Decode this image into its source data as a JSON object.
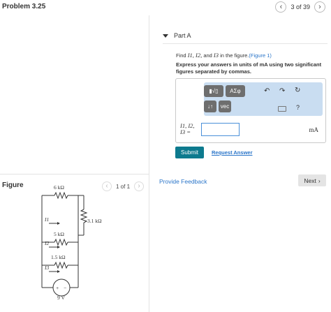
{
  "header": {
    "problem_title": "Problem 3.25",
    "pager_text": "3 of 39",
    "prev_icon": "chevron-left-icon",
    "next_icon": "chevron-right-icon"
  },
  "part": {
    "label": "Part A",
    "prompt_prefix": "Find ",
    "prompt_vars": "I1, I2,",
    "prompt_mid": " and ",
    "prompt_var3": "I3",
    "prompt_suffix": " in the figure.",
    "figure_link": "(Figure 1)",
    "instruction": "Express your answers in units of mA using two significant figures separated by commas."
  },
  "toolbar": {
    "templates_icon": "templates-icon",
    "greek_label": "ΑΣφ",
    "sort_label": "↓↑",
    "vec_label": "vec",
    "undo_icon": "undo-icon",
    "redo_icon": "redo-icon",
    "reset_icon": "reset-icon",
    "keyboard_icon": "keyboard-icon",
    "help_label": "?"
  },
  "answer": {
    "label_line1": "I1, I2,",
    "label_line2": "I3 =",
    "value": "",
    "unit": "mA"
  },
  "actions": {
    "submit_label": "Submit",
    "request_answer_label": "Request Answer",
    "feedback_label": "Provide Feedback",
    "next_label": "Next"
  },
  "figure": {
    "label": "Figure",
    "pager_text": "1 of 1",
    "r1": "6 kΩ",
    "r2": "3.1 kΩ",
    "r3": "5 kΩ",
    "r4": "1.5 kΩ",
    "source": "9 V",
    "i1": "I1",
    "i2": "I2",
    "i3": "I3",
    "plus": "+",
    "minus": "−"
  },
  "colors": {
    "accent": "#0d7a8e",
    "link": "#2a75c9",
    "toolbar_bg": "#c9ddf1"
  }
}
